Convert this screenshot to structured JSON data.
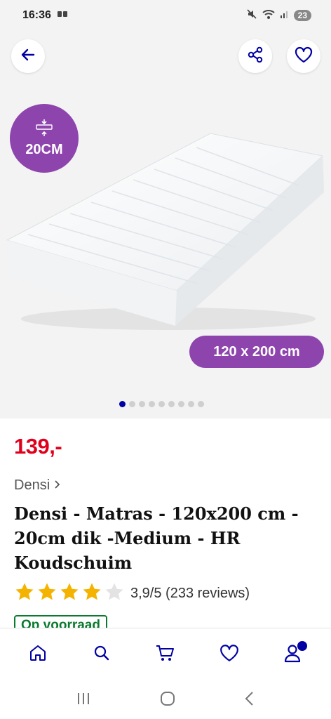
{
  "status": {
    "time": "16:36",
    "battery": "23"
  },
  "product": {
    "thickness_badge": "20CM",
    "size_label": "120 x 200 cm",
    "image_count": 9,
    "active_image": 1,
    "price": "139,-",
    "brand": "Densi",
    "title": "Densi - Matras - 120x200 cm - 20cm dik -Medium - HR Koudschuim",
    "rating_value": 3.9,
    "rating_text": "3,9/5 (233 reviews)",
    "stock_label": "Op voorraad"
  },
  "bottom_nav": {
    "items": [
      "home-icon",
      "search-icon",
      "cart-icon",
      "heart-icon",
      "account-icon"
    ],
    "accent": "#0000a4"
  },
  "colors": {
    "price": "#e0001b",
    "badge": "#8e44ad",
    "stock": "#0a7a2e"
  }
}
